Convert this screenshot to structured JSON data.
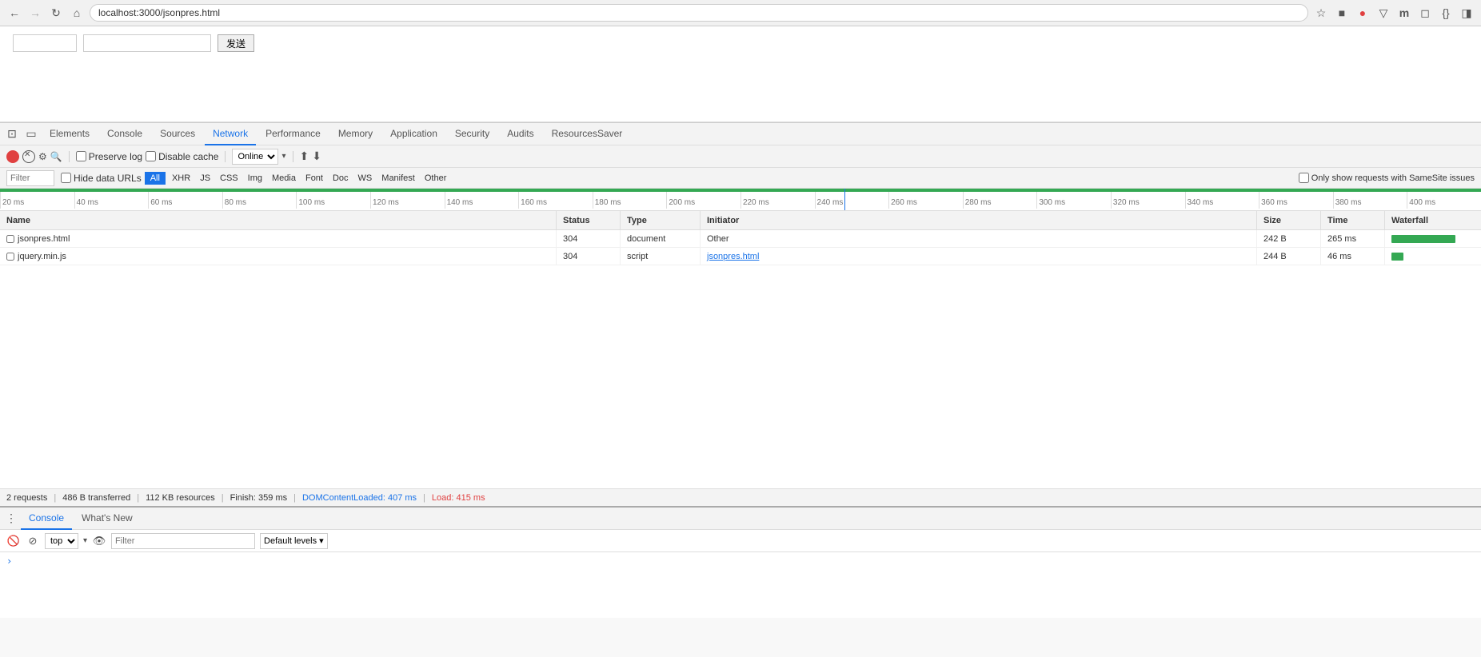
{
  "browser": {
    "address": "localhost:3000/jsonpres.html",
    "back_label": "←",
    "forward_label": "→",
    "reload_label": "↻",
    "home_label": "⌂"
  },
  "page": {
    "input1_placeholder": "",
    "input2_placeholder": "",
    "send_button": "发送"
  },
  "devtools": {
    "tabs": [
      {
        "label": "Elements",
        "active": false
      },
      {
        "label": "Console",
        "active": false
      },
      {
        "label": "Sources",
        "active": false
      },
      {
        "label": "Network",
        "active": true
      },
      {
        "label": "Performance",
        "active": false
      },
      {
        "label": "Memory",
        "active": false
      },
      {
        "label": "Application",
        "active": false
      },
      {
        "label": "Security",
        "active": false
      },
      {
        "label": "Audits",
        "active": false
      },
      {
        "label": "ResourcesSaver",
        "active": false
      }
    ],
    "network": {
      "preserve_log_label": "Preserve log",
      "disable_cache_label": "Disable cache",
      "online_option": "Online",
      "filter_label": "Filter",
      "hide_data_urls_label": "Hide data URLs",
      "filter_types": [
        "All",
        "XHR",
        "JS",
        "CSS",
        "Img",
        "Media",
        "Font",
        "Doc",
        "WS",
        "Manifest",
        "Other"
      ],
      "active_filter": "All",
      "only_samesite_label": "Only show requests with SameSite issues",
      "timeline": {
        "marks": [
          "20 ms",
          "40 ms",
          "60 ms",
          "80 ms",
          "100 ms",
          "120 ms",
          "140 ms",
          "160 ms",
          "180 ms",
          "200 ms",
          "220 ms",
          "240 ms",
          "260 ms",
          "280 ms",
          "300 ms",
          "320 ms",
          "340 ms",
          "360 ms",
          "380 ms",
          "400 ms"
        ]
      },
      "columns": [
        "Name",
        "Status",
        "Type",
        "Initiator",
        "Size",
        "Time",
        "Waterfall"
      ],
      "rows": [
        {
          "name": "jsonpres.html",
          "status": "304",
          "type": "document",
          "initiator": "Other",
          "initiator_link": false,
          "size": "242 B",
          "time": "265 ms",
          "waterfall_width": 80
        },
        {
          "name": "jquery.min.js",
          "status": "304",
          "type": "script",
          "initiator": "jsonpres.html",
          "initiator_link": true,
          "size": "244 B",
          "time": "46 ms",
          "waterfall_width": 15
        }
      ],
      "status_bar": {
        "requests": "2 requests",
        "transferred": "486 B transferred",
        "resources": "112 KB resources",
        "finish": "Finish: 359 ms",
        "domcontent": "DOMContentLoaded: 407 ms",
        "load": "Load: 415 ms"
      }
    }
  },
  "console_panel": {
    "tabs": [
      {
        "label": "Console",
        "active": true
      },
      {
        "label": "What's New",
        "active": false
      }
    ],
    "context": "top",
    "filter_placeholder": "Filter",
    "default_levels": "Default levels ▾"
  }
}
